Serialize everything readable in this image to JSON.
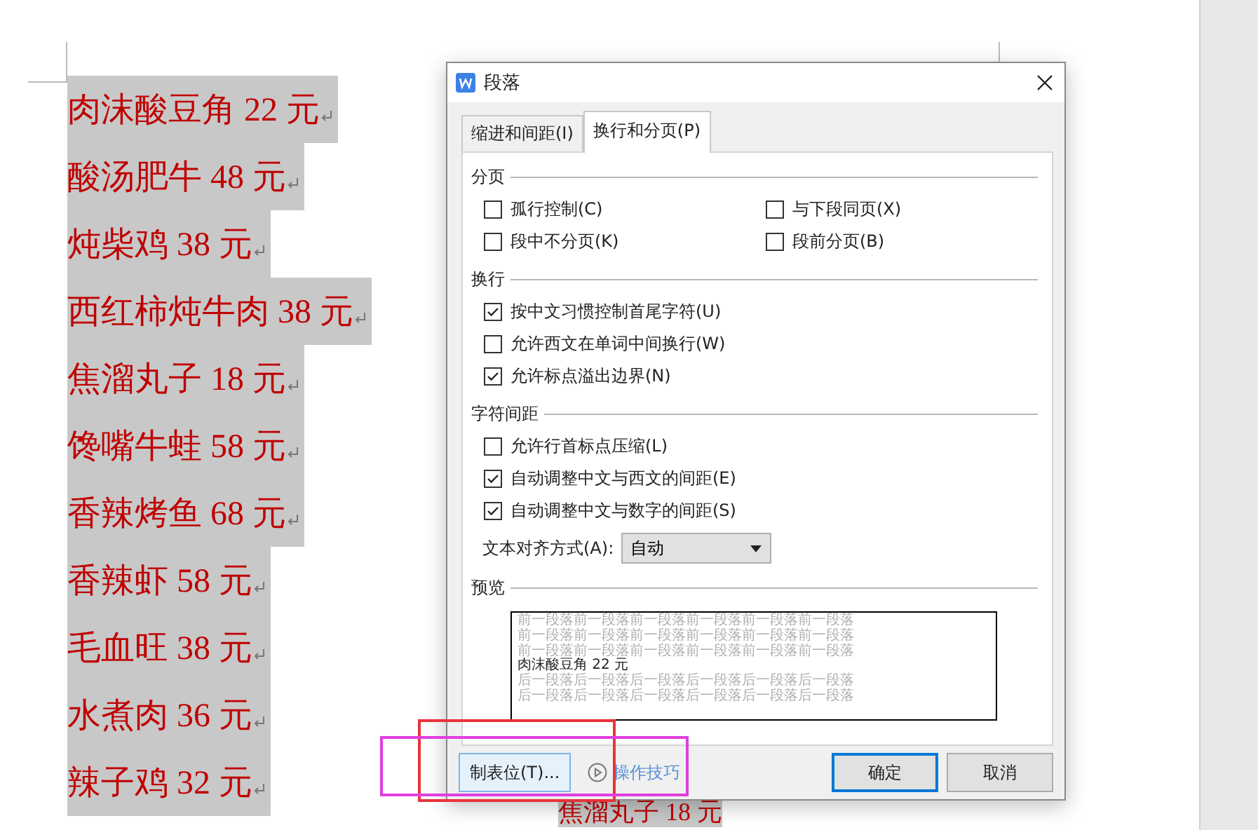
{
  "document": {
    "lines": [
      {
        "text": "肉沫酸豆角 22 元"
      },
      {
        "text": "酸汤肥牛 48 元"
      },
      {
        "text": "炖柴鸡 38 元"
      },
      {
        "text": "西红柿炖牛肉 38 元"
      },
      {
        "text": "焦溜丸子 18 元"
      },
      {
        "text": "馋嘴牛蛙 58 元"
      },
      {
        "text": "香辣烤鱼 68 元"
      },
      {
        "text": "香辣虾 58 元"
      },
      {
        "text": "毛血旺 38 元"
      },
      {
        "text": "水煮肉 36 元"
      },
      {
        "text": "辣子鸡 32 元"
      }
    ],
    "behind_dialog_line": "焦溜丸子 18 元"
  },
  "dialog": {
    "title": "段落",
    "tabs": [
      {
        "label": "缩进和间距(I)",
        "selected": false
      },
      {
        "label": "换行和分页(P)",
        "selected": true
      }
    ],
    "sections": [
      {
        "title": "分页",
        "kind": "grid",
        "options": [
          {
            "label": "孤行控制(C)",
            "checked": false
          },
          {
            "label": "与下段同页(X)",
            "checked": false
          },
          {
            "label": "段中不分页(K)",
            "checked": false
          },
          {
            "label": "段前分页(B)",
            "checked": false
          }
        ]
      },
      {
        "title": "换行",
        "kind": "list",
        "options": [
          {
            "label": "按中文习惯控制首尾字符(U)",
            "checked": true
          },
          {
            "label": "允许西文在单词中间换行(W)",
            "checked": false
          },
          {
            "label": "允许标点溢出边界(N)",
            "checked": true
          }
        ]
      },
      {
        "title": "字符间距",
        "kind": "list",
        "options": [
          {
            "label": "允许行首标点压缩(L)",
            "checked": false
          },
          {
            "label": "自动调整中文与西文的间距(E)",
            "checked": true
          },
          {
            "label": "自动调整中文与数字的间距(S)",
            "checked": true
          }
        ],
        "align": {
          "label": "文本对齐方式(A):",
          "value": "自动"
        }
      }
    ],
    "preview": {
      "title": "预览",
      "before": [
        "前一段落前一段落前一段落前一段落前一段落前一段落",
        "前一段落前一段落前一段落前一段落前一段落前一段落",
        "前一段落前一段落前一段落前一段落前一段落前一段落"
      ],
      "sample": "肉沫酸豆角 22 元",
      "after": [
        "后一段落后一段落后一段落后一段落后一段落后一段落",
        "后一段落后一段落后一段落后一段落后一段落后一段落"
      ]
    },
    "tabs_button": "制表位(T)...",
    "tips_link": "操作技巧",
    "ok_button": "确定",
    "cancel_button": "取消"
  },
  "annotations": [
    {
      "color": "#e8333a"
    },
    {
      "color": "#e03ee0"
    }
  ]
}
